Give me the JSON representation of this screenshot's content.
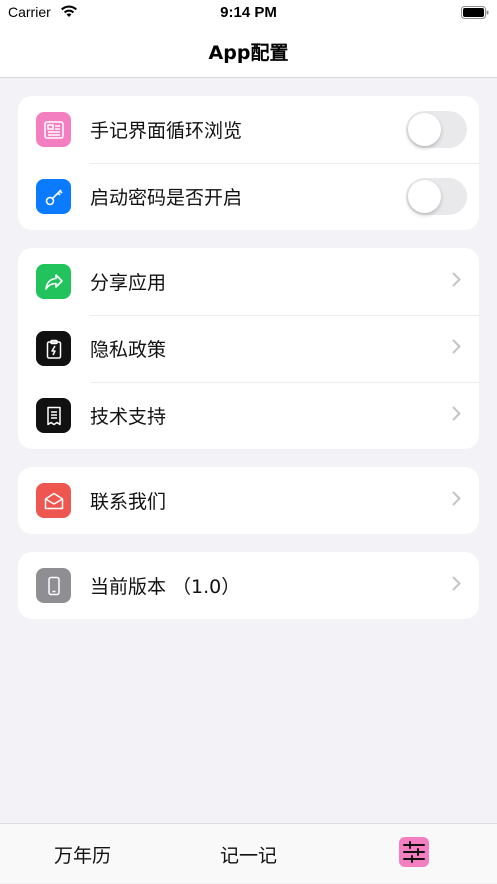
{
  "status_bar": {
    "carrier": "Carrier",
    "time": "9:14 PM"
  },
  "nav": {
    "title": "App配置"
  },
  "groups": [
    {
      "rows": [
        {
          "label": "手记界面循环浏览",
          "icon": "notes-icon",
          "icon_color": "#f47fc0",
          "control": "toggle",
          "enabled": false
        },
        {
          "label": "启动密码是否开启",
          "icon": "key-icon",
          "icon_color": "#0a7aff",
          "control": "toggle",
          "enabled": false
        }
      ]
    },
    {
      "rows": [
        {
          "label": "分享应用",
          "icon": "share-icon",
          "icon_color": "#22c35c",
          "control": "chevron"
        },
        {
          "label": "隐私政策",
          "icon": "privacy-icon",
          "icon_color": "#111111",
          "control": "chevron"
        },
        {
          "label": "技术支持",
          "icon": "receipt-icon",
          "icon_color": "#111111",
          "control": "chevron"
        }
      ]
    },
    {
      "rows": [
        {
          "label": "联系我们",
          "icon": "mail-icon",
          "icon_color": "#ee5650",
          "control": "chevron"
        }
      ]
    },
    {
      "rows": [
        {
          "label": "当前版本 （1.0）",
          "icon": "phone-icon",
          "icon_color": "#8e8e93",
          "control": "chevron"
        }
      ]
    }
  ],
  "tabbar": {
    "tabs": [
      {
        "label": "万年历"
      },
      {
        "label": "记一记"
      },
      {
        "label": "",
        "icon": "sliders-icon",
        "icon_color": "#f47fc0",
        "selected": true
      }
    ]
  },
  "colors": {
    "background": "#f2f2f7",
    "toggle_off": "#e9e9eb",
    "chevron": "#c4c4c7"
  }
}
